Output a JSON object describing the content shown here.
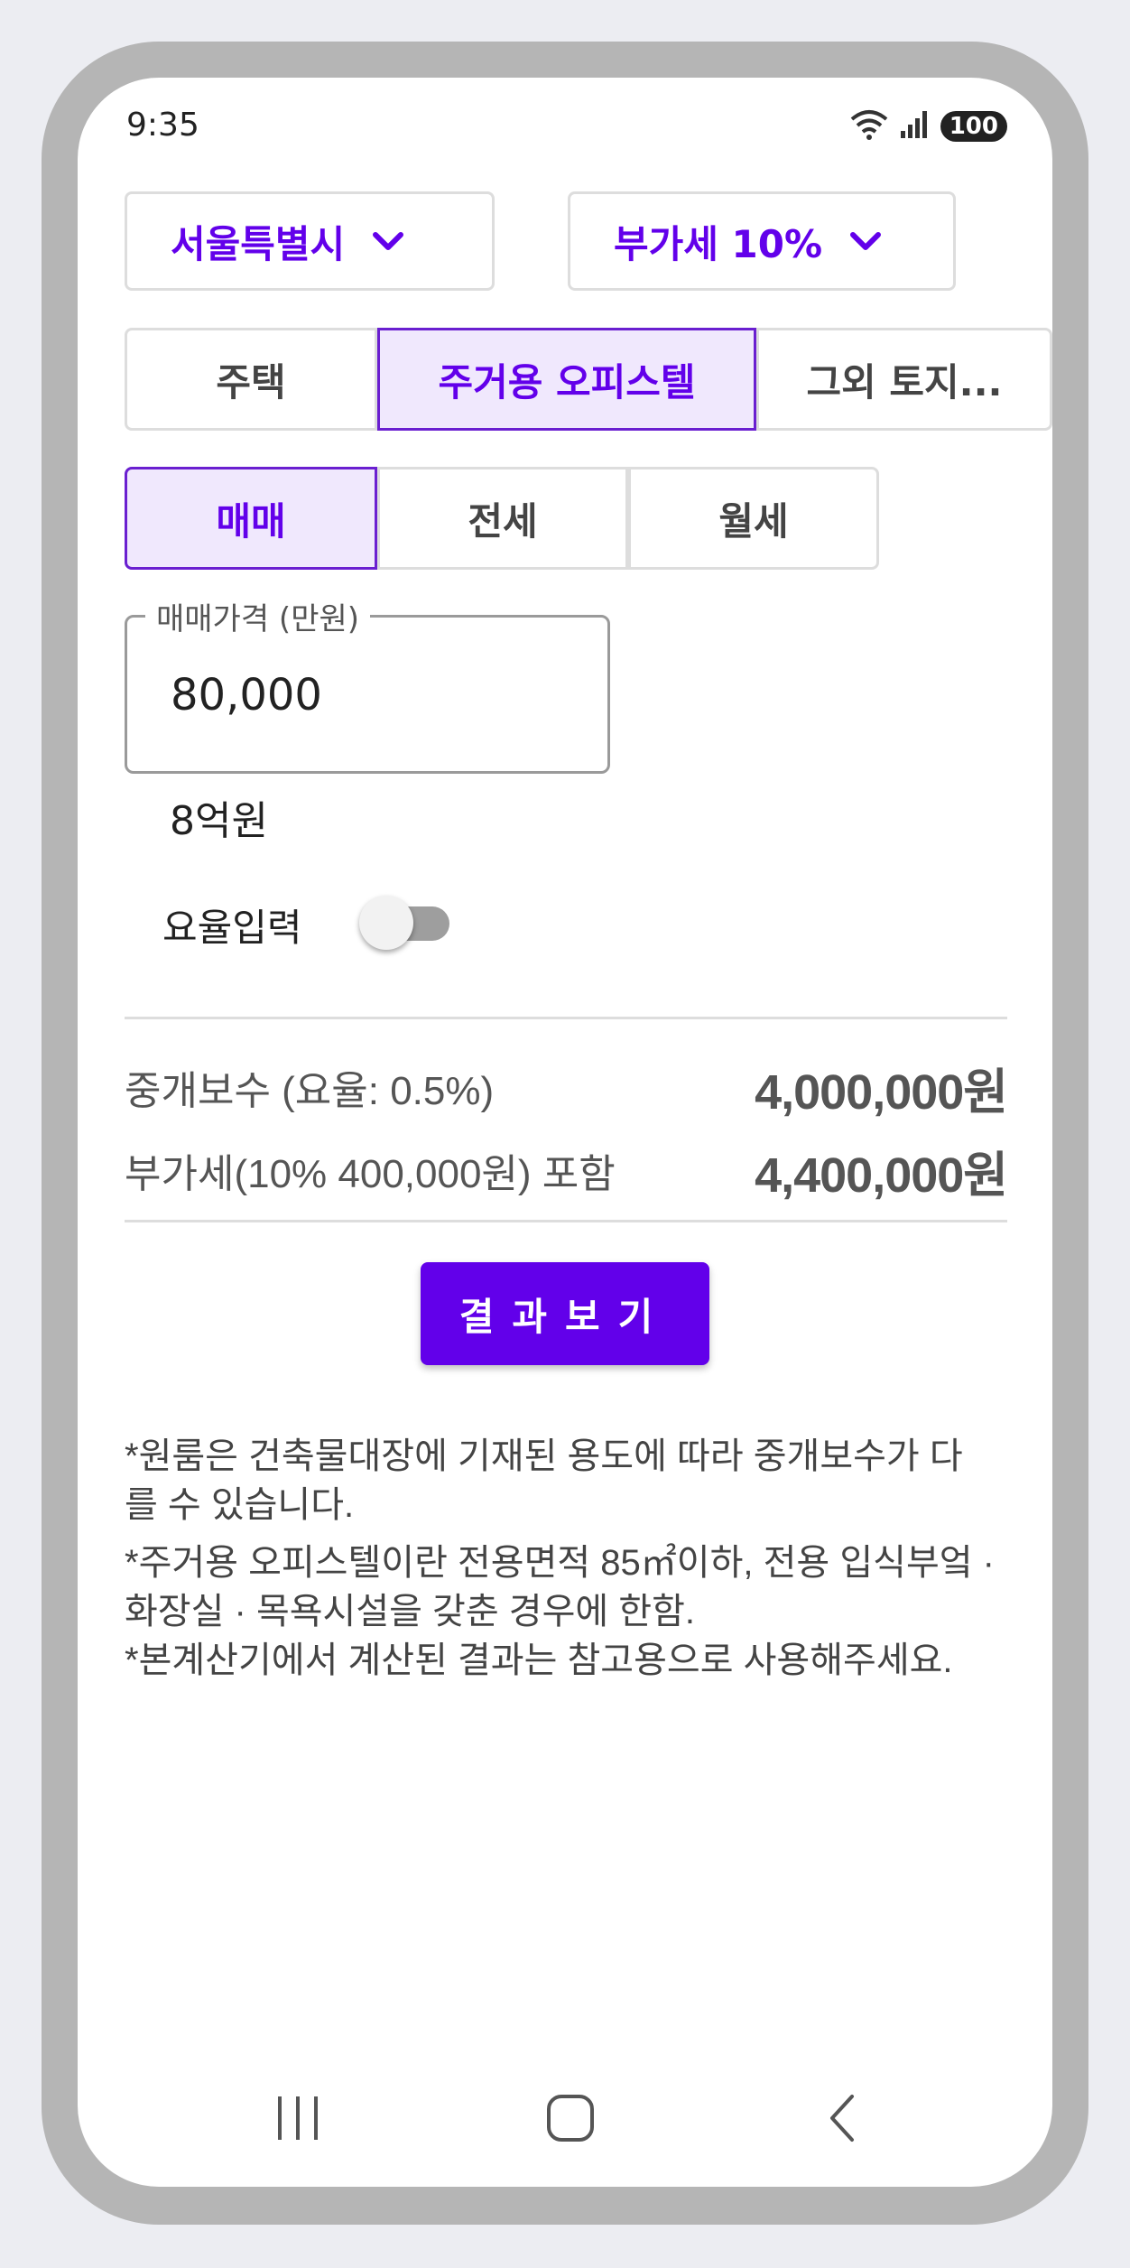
{
  "status_bar": {
    "time": "9:35",
    "battery": "100"
  },
  "filters": {
    "region": {
      "label": "서울특별시",
      "icon": "chevron-down-icon"
    },
    "vat": {
      "label": "부가세 10%",
      "icon": "chevron-down-icon"
    }
  },
  "property_tabs": [
    {
      "label": "주택",
      "active": false
    },
    {
      "label": "주거용 오피스텔",
      "active": true
    },
    {
      "label": "그외 토지...",
      "active": false
    }
  ],
  "deal_tabs": [
    {
      "label": "매매",
      "active": true
    },
    {
      "label": "전세",
      "active": false
    },
    {
      "label": "월세",
      "active": false
    }
  ],
  "price_input": {
    "label": "매매가격 (만원)",
    "value": "80,000",
    "words": "8억원"
  },
  "rate_toggle": {
    "label": "요율입력",
    "checked": false
  },
  "results": {
    "fee_label": "중개보수 (요율: 0.5%)",
    "fee_value": "4,000,000원",
    "vat_label": "부가세(10% 400,000원) 포함",
    "vat_value": "4,400,000원"
  },
  "result_button": "결과보기",
  "notes": [
    "*원룸은 건축물대장에 기재된 용도에 따라 중개보수가 다를 수 있습니다.",
    "*주거용 오피스텔이란 전용면적 85㎡이하, 전용 입식부엌 · 화장실 · 목욕시설을 갖춘 경우에 한함.",
    "*본계산기에서 계산된 결과는 참고용으로 사용해주세요."
  ],
  "colors": {
    "accent": "#6200ea",
    "accent_bg": "#f0e8fd",
    "border": "#dddddd"
  }
}
